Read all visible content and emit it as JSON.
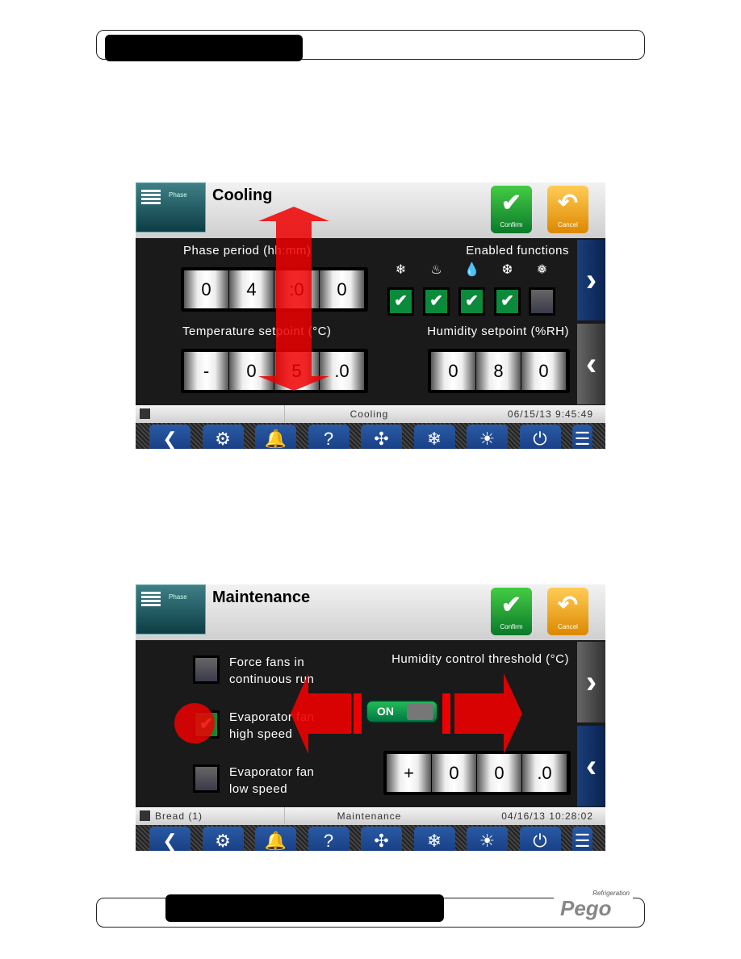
{
  "toolbar": [
    {
      "label": "Back",
      "icon": "back-icon",
      "glyph": "❮"
    },
    {
      "label": "Settings",
      "icon": "gears-icon",
      "glyph": "⚙"
    },
    {
      "label": "Alarm",
      "icon": "bell-icon",
      "glyph": "🔔"
    },
    {
      "label": "Help",
      "icon": "help-icon",
      "glyph": "?"
    },
    {
      "label": "Air cycle",
      "icon": "fan-icon",
      "glyph": "✣"
    },
    {
      "label": "Defrost",
      "icon": "defrost-icon",
      "glyph": "❄"
    },
    {
      "label": "Light",
      "icon": "light-icon",
      "glyph": "☀"
    },
    {
      "label": "Standby",
      "icon": "power-icon",
      "glyph": "⏻"
    },
    {
      "label": "",
      "icon": "menu-icon",
      "glyph": "☰"
    }
  ],
  "common": {
    "phase_label": "Phase",
    "confirm": "Confirm",
    "cancel": "Cancel"
  },
  "screen1": {
    "title": "Cooling",
    "phase_period_label": "Phase  period (hh:mm)",
    "phase_period": [
      "0",
      "4",
      ":0",
      "0"
    ],
    "enabled_functions_label": "Enabled functions",
    "functions": [
      {
        "icon": "snowflake-icon",
        "glyph": "❄",
        "enabled": true
      },
      {
        "icon": "heater-icon",
        "glyph": "♨",
        "enabled": true
      },
      {
        "icon": "humidify-icon",
        "glyph": "💧",
        "enabled": true
      },
      {
        "icon": "dehumidify-icon",
        "glyph": "❆",
        "enabled": true
      },
      {
        "icon": "defrost-drip-icon",
        "glyph": "❅",
        "enabled": false
      }
    ],
    "temp_setpoint_label": "Temperature  setpoint (°C)",
    "temp_setpoint": [
      "-",
      "0",
      "5",
      ".0"
    ],
    "humidity_setpoint_label": "Humidity  setpoint (%RH)",
    "humidity_setpoint": [
      "0",
      "8",
      "0"
    ],
    "status_left": "",
    "status_mid": "Cooling",
    "status_datetime": "06/15/13   9:45:49"
  },
  "screen2": {
    "title": "Maintenance",
    "force_fans": "Force fans in",
    "force_fans2": "continuous run",
    "evap_high": "Evaporator  fan",
    "evap_high2": "high  speed",
    "evap_low": "Evaporator  fan",
    "evap_low2": "low  speed",
    "force_fans_checked": false,
    "evap_high_checked": true,
    "evap_low_checked": false,
    "threshold_label": "Humidity control threshold (°C)",
    "toggle": "ON",
    "threshold": [
      "+",
      "0",
      "0",
      ".0"
    ],
    "status_left": "Bread (1)",
    "status_mid": "Maintenance",
    "status_datetime": "04/16/13   10:28:02"
  },
  "logo": {
    "brand": "Pego",
    "sub": "Refrigeration"
  }
}
